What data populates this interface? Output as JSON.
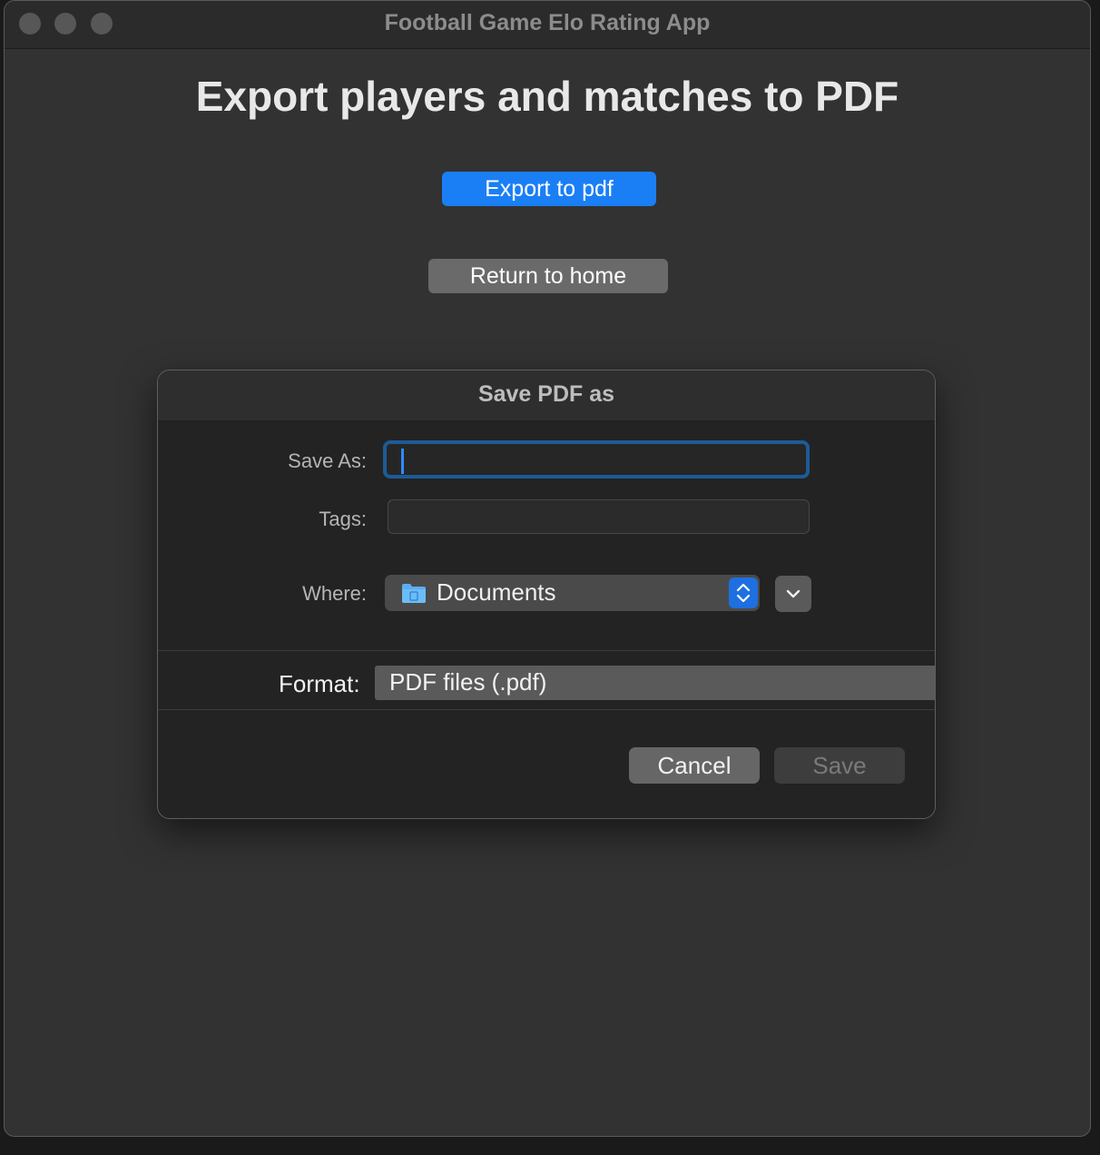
{
  "window": {
    "title": "Football Game Elo Rating App",
    "controls": [
      "close-icon",
      "minimize-icon",
      "zoom-icon"
    ]
  },
  "main": {
    "heading": "Export players and matches to PDF",
    "export_label": "Export to pdf",
    "return_label": "Return to home"
  },
  "dialog": {
    "title": "Save PDF as",
    "save_as_label": "Save As:",
    "save_as_value": "",
    "tags_label": "Tags:",
    "tags_value": "",
    "where_label": "Where:",
    "where_value": "Documents",
    "where_icon": "folder-icon",
    "format_label": "Format:",
    "format_value": "PDF files (.pdf)",
    "cancel_label": "Cancel",
    "save_label": "Save"
  },
  "colors": {
    "accent": "#1a7ff5",
    "focus_ring": "#1c5b98",
    "window_bg": "#323232",
    "sheet_bg": "#232323"
  }
}
